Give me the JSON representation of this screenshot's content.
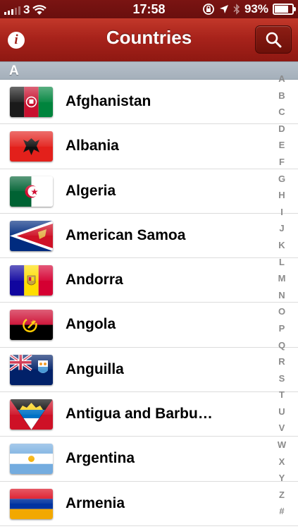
{
  "status_bar": {
    "carrier": "3",
    "time": "17:58",
    "battery": "93%",
    "battery_level": 0.93
  },
  "nav": {
    "title": "Countries",
    "info_icon": "info-icon",
    "search_icon": "search-icon"
  },
  "section": {
    "header": "A"
  },
  "countries": [
    {
      "name": "Afghanistan"
    },
    {
      "name": "Albania"
    },
    {
      "name": "Algeria"
    },
    {
      "name": "American Samoa"
    },
    {
      "name": "Andorra"
    },
    {
      "name": "Angola"
    },
    {
      "name": "Anguilla"
    },
    {
      "name": "Antigua and Barbu…"
    },
    {
      "name": "Argentina"
    },
    {
      "name": "Armenia"
    }
  ],
  "index": [
    "A",
    "B",
    "C",
    "D",
    "E",
    "F",
    "G",
    "H",
    "I",
    "J",
    "K",
    "L",
    "M",
    "N",
    "O",
    "P",
    "Q",
    "R",
    "S",
    "T",
    "U",
    "V",
    "W",
    "X",
    "Y",
    "Z",
    "#"
  ],
  "colors": {
    "nav_red": "#a8231b",
    "section_gray": "#a5b0bb",
    "index_gray": "#8b8b8b"
  }
}
